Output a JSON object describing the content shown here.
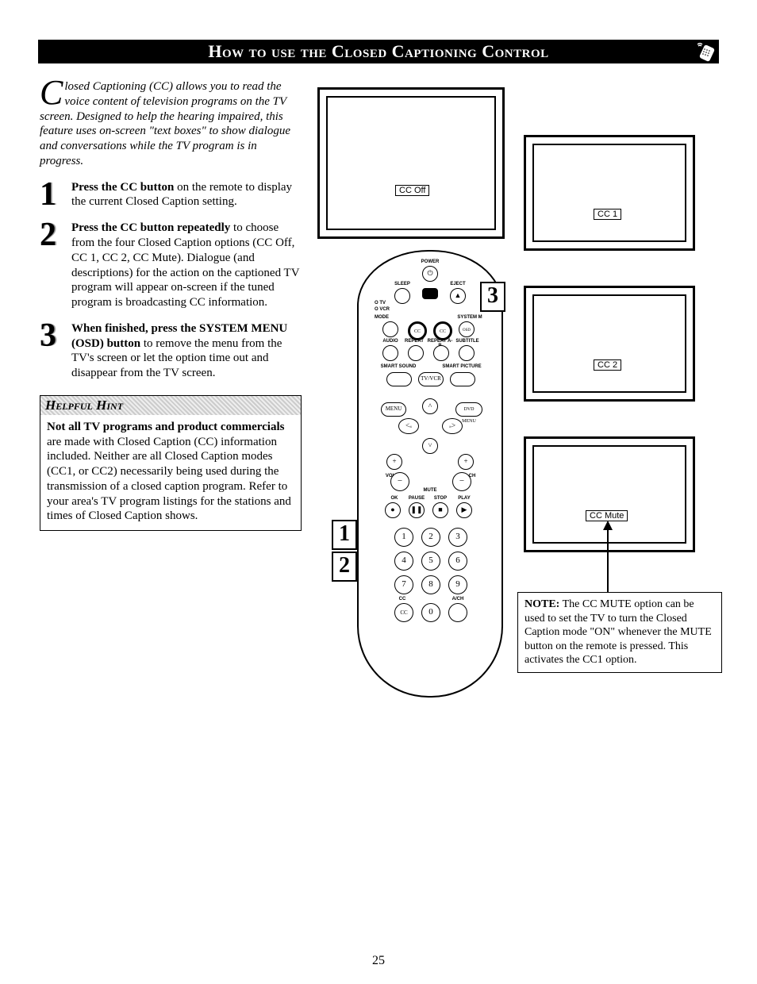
{
  "header": {
    "title": "How to use the Closed Captioning Control"
  },
  "intro": {
    "dropcap": "C",
    "text": "losed Captioning (CC) allows you to read the voice content of television programs on the TV screen. Designed to help the hearing impaired, this feature uses on-screen \"text boxes\" to show dialogue and conversations while the TV program is in progress."
  },
  "steps": [
    {
      "num": "1",
      "bold": "Press the CC button",
      "rest": " on the remote to display the current Closed Caption setting."
    },
    {
      "num": "2",
      "bold": "Press the CC button repeatedly",
      "rest": " to choose from the four Closed Caption options (CC Off, CC 1, CC 2, CC Mute). Dialogue (and descriptions) for the action on the captioned TV program will appear on-screen if the tuned program is broadcasting CC information."
    },
    {
      "num": "3",
      "bold": "When finished, press the SYSTEM MENU (OSD) button",
      "rest": " to remove the menu from the TV's screen or let the option time out and disappear from the TV screen."
    }
  ],
  "hint": {
    "title": "Helpful Hint",
    "bold": "Not all TV programs and product commercials",
    "body": " are made with Closed Caption (CC) information included. Neither are all Closed Caption modes (CC1, or CC2) necessarily being used during the transmission of a closed caption program. Refer to your area's TV program listings for the stations and times of Closed Caption shows."
  },
  "tv_labels": {
    "off": "CC Off",
    "cc1": "CC 1",
    "cc2": "CC 2",
    "ccmute": "CC Mute"
  },
  "remote_labels": {
    "power": "POWER",
    "sleep": "SLEEP",
    "eject": "EJECT",
    "tv": "O TV",
    "vcr": "O VCR",
    "mode": "MODE",
    "systemmenu": "SYSTEM M",
    "osd": "OSD",
    "audio": "AUDIO",
    "repeat": "REPEAT",
    "repeatab": "REPEAT A-B",
    "subtitle": "SUBTITLE",
    "smartsound": "SMART SOUND",
    "smartpicture": "SMART PICTURE",
    "menu": "MENU",
    "dvdmenu": "DVD MENU",
    "tvvcr": "TV/VCR",
    "vol": "VOL",
    "ch": "CH",
    "mute": "MUTE",
    "ok": "OK",
    "pause": "PAUSE",
    "stop": "STOP",
    "play": "PLAY",
    "cc": "CC",
    "acp": "A/CH"
  },
  "callouts": {
    "c1": "1",
    "c2": "2",
    "c3": "3"
  },
  "note": {
    "bold": "NOTE:",
    "body": " The CC MUTE option can be used to set the TV to turn the Closed Caption mode \"ON\" whenever the MUTE button on the remote is pressed. This activates the CC1 option."
  },
  "page_number": "25"
}
